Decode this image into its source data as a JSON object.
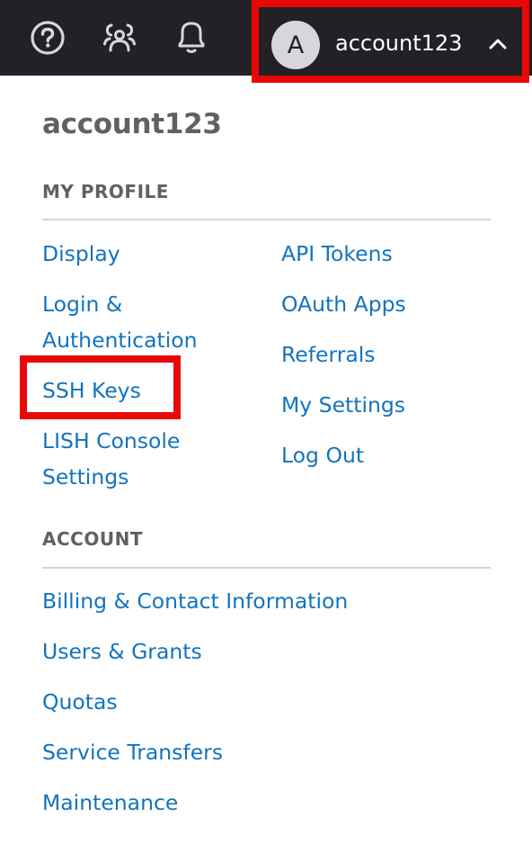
{
  "topbar": {
    "icons": [
      "help-icon",
      "people-icon",
      "bell-icon"
    ],
    "account": {
      "avatar_initial": "A",
      "username": "account123",
      "chevron": "chevron-up-icon"
    }
  },
  "menu": {
    "title": "account123",
    "my_profile": {
      "heading": "MY PROFILE",
      "left_links": [
        "Display",
        "Login &",
        "Authentication",
        "SSH Keys",
        "LISH Console",
        "Settings"
      ],
      "right_links": [
        "API Tokens",
        "OAuth Apps",
        "Referrals",
        "My Settings",
        "Log Out"
      ]
    },
    "account": {
      "heading": "ACCOUNT",
      "links": [
        "Billing & Contact Information",
        "Users & Grants",
        "Quotas",
        "Service Transfers",
        "Maintenance"
      ]
    }
  },
  "colors": {
    "topbar_bg": "#222226",
    "link": "#1373be",
    "heading": "#606065",
    "highlight": "#e80808"
  }
}
